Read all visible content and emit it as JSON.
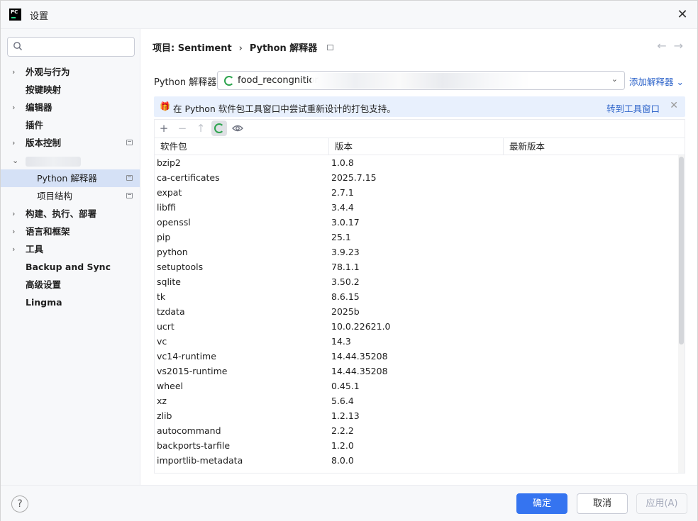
{
  "window": {
    "title": "设置",
    "app_icon_text": "PC"
  },
  "sidebar": {
    "search_placeholder": "",
    "items": [
      {
        "label": "外观与行为",
        "expand": "›",
        "level": 0
      },
      {
        "label": "按键映射",
        "level": 0
      },
      {
        "label": "编辑器",
        "expand": "›",
        "level": 0
      },
      {
        "label": "插件",
        "level": 0
      },
      {
        "label": "版本控制",
        "expand": "›",
        "level": 0
      },
      {
        "label": "",
        "expand": "⌄",
        "level": 0
      },
      {
        "label": "Python 解释器",
        "level": 1,
        "selected": true
      },
      {
        "label": "项目结构",
        "level": 1
      },
      {
        "label": "构建、执行、部署",
        "expand": "›",
        "level": 0
      },
      {
        "label": "语言和框架",
        "expand": "›",
        "level": 0
      },
      {
        "label": "工具",
        "expand": "›",
        "level": 0
      },
      {
        "label": "Backup and Sync",
        "level": 0
      },
      {
        "label": "高级设置",
        "level": 0
      },
      {
        "label": "Lingma",
        "level": 0
      }
    ]
  },
  "breadcrumb": {
    "project": "项目: Sentiment",
    "sep": "›",
    "page": "Python 解释器"
  },
  "nav": {
    "back": "←",
    "forward": "→"
  },
  "interpreter": {
    "label": "Python 解释器:",
    "value": "food_recongnitior",
    "add_label": "添加解释器 ⌄"
  },
  "banner": {
    "icon": "🎁",
    "message": "在 Python 软件包工具窗口中尝试重新设计的打包支持。",
    "link": "转到工具窗口",
    "close": "✕"
  },
  "toolbar": {
    "add": "+",
    "remove": "−",
    "upgrade": "↑",
    "show": "◉"
  },
  "table": {
    "headers": [
      "软件包",
      "版本",
      "最新版本"
    ],
    "rows": [
      [
        "bzip2",
        "1.0.8",
        ""
      ],
      [
        "ca-certificates",
        "2025.7.15",
        ""
      ],
      [
        "expat",
        "2.7.1",
        ""
      ],
      [
        "libffi",
        "3.4.4",
        ""
      ],
      [
        "openssl",
        "3.0.17",
        ""
      ],
      [
        "pip",
        "25.1",
        ""
      ],
      [
        "python",
        "3.9.23",
        ""
      ],
      [
        "setuptools",
        "78.1.1",
        ""
      ],
      [
        "sqlite",
        "3.50.2",
        ""
      ],
      [
        "tk",
        "8.6.15",
        ""
      ],
      [
        "tzdata",
        "2025b",
        ""
      ],
      [
        "ucrt",
        "10.0.22621.0",
        ""
      ],
      [
        "vc",
        "14.3",
        ""
      ],
      [
        "vc14-runtime",
        "14.44.35208",
        ""
      ],
      [
        "vs2015-runtime",
        "14.44.35208",
        ""
      ],
      [
        "wheel",
        "0.45.1",
        ""
      ],
      [
        "xz",
        "5.6.4",
        ""
      ],
      [
        "zlib",
        "1.2.13",
        ""
      ],
      [
        "autocommand",
        "2.2.2",
        ""
      ],
      [
        "backports-tarfile",
        "1.2.0",
        ""
      ],
      [
        "importlib-metadata",
        "8.0.0",
        ""
      ]
    ]
  },
  "footer": {
    "help": "?",
    "ok": "确定",
    "cancel": "取消",
    "apply": "应用(A)"
  },
  "colors": {
    "accent": "#3574f0",
    "selected_bg": "#d5e1f6",
    "link": "#2f65ca",
    "banner_bg": "#e8f0fd"
  }
}
